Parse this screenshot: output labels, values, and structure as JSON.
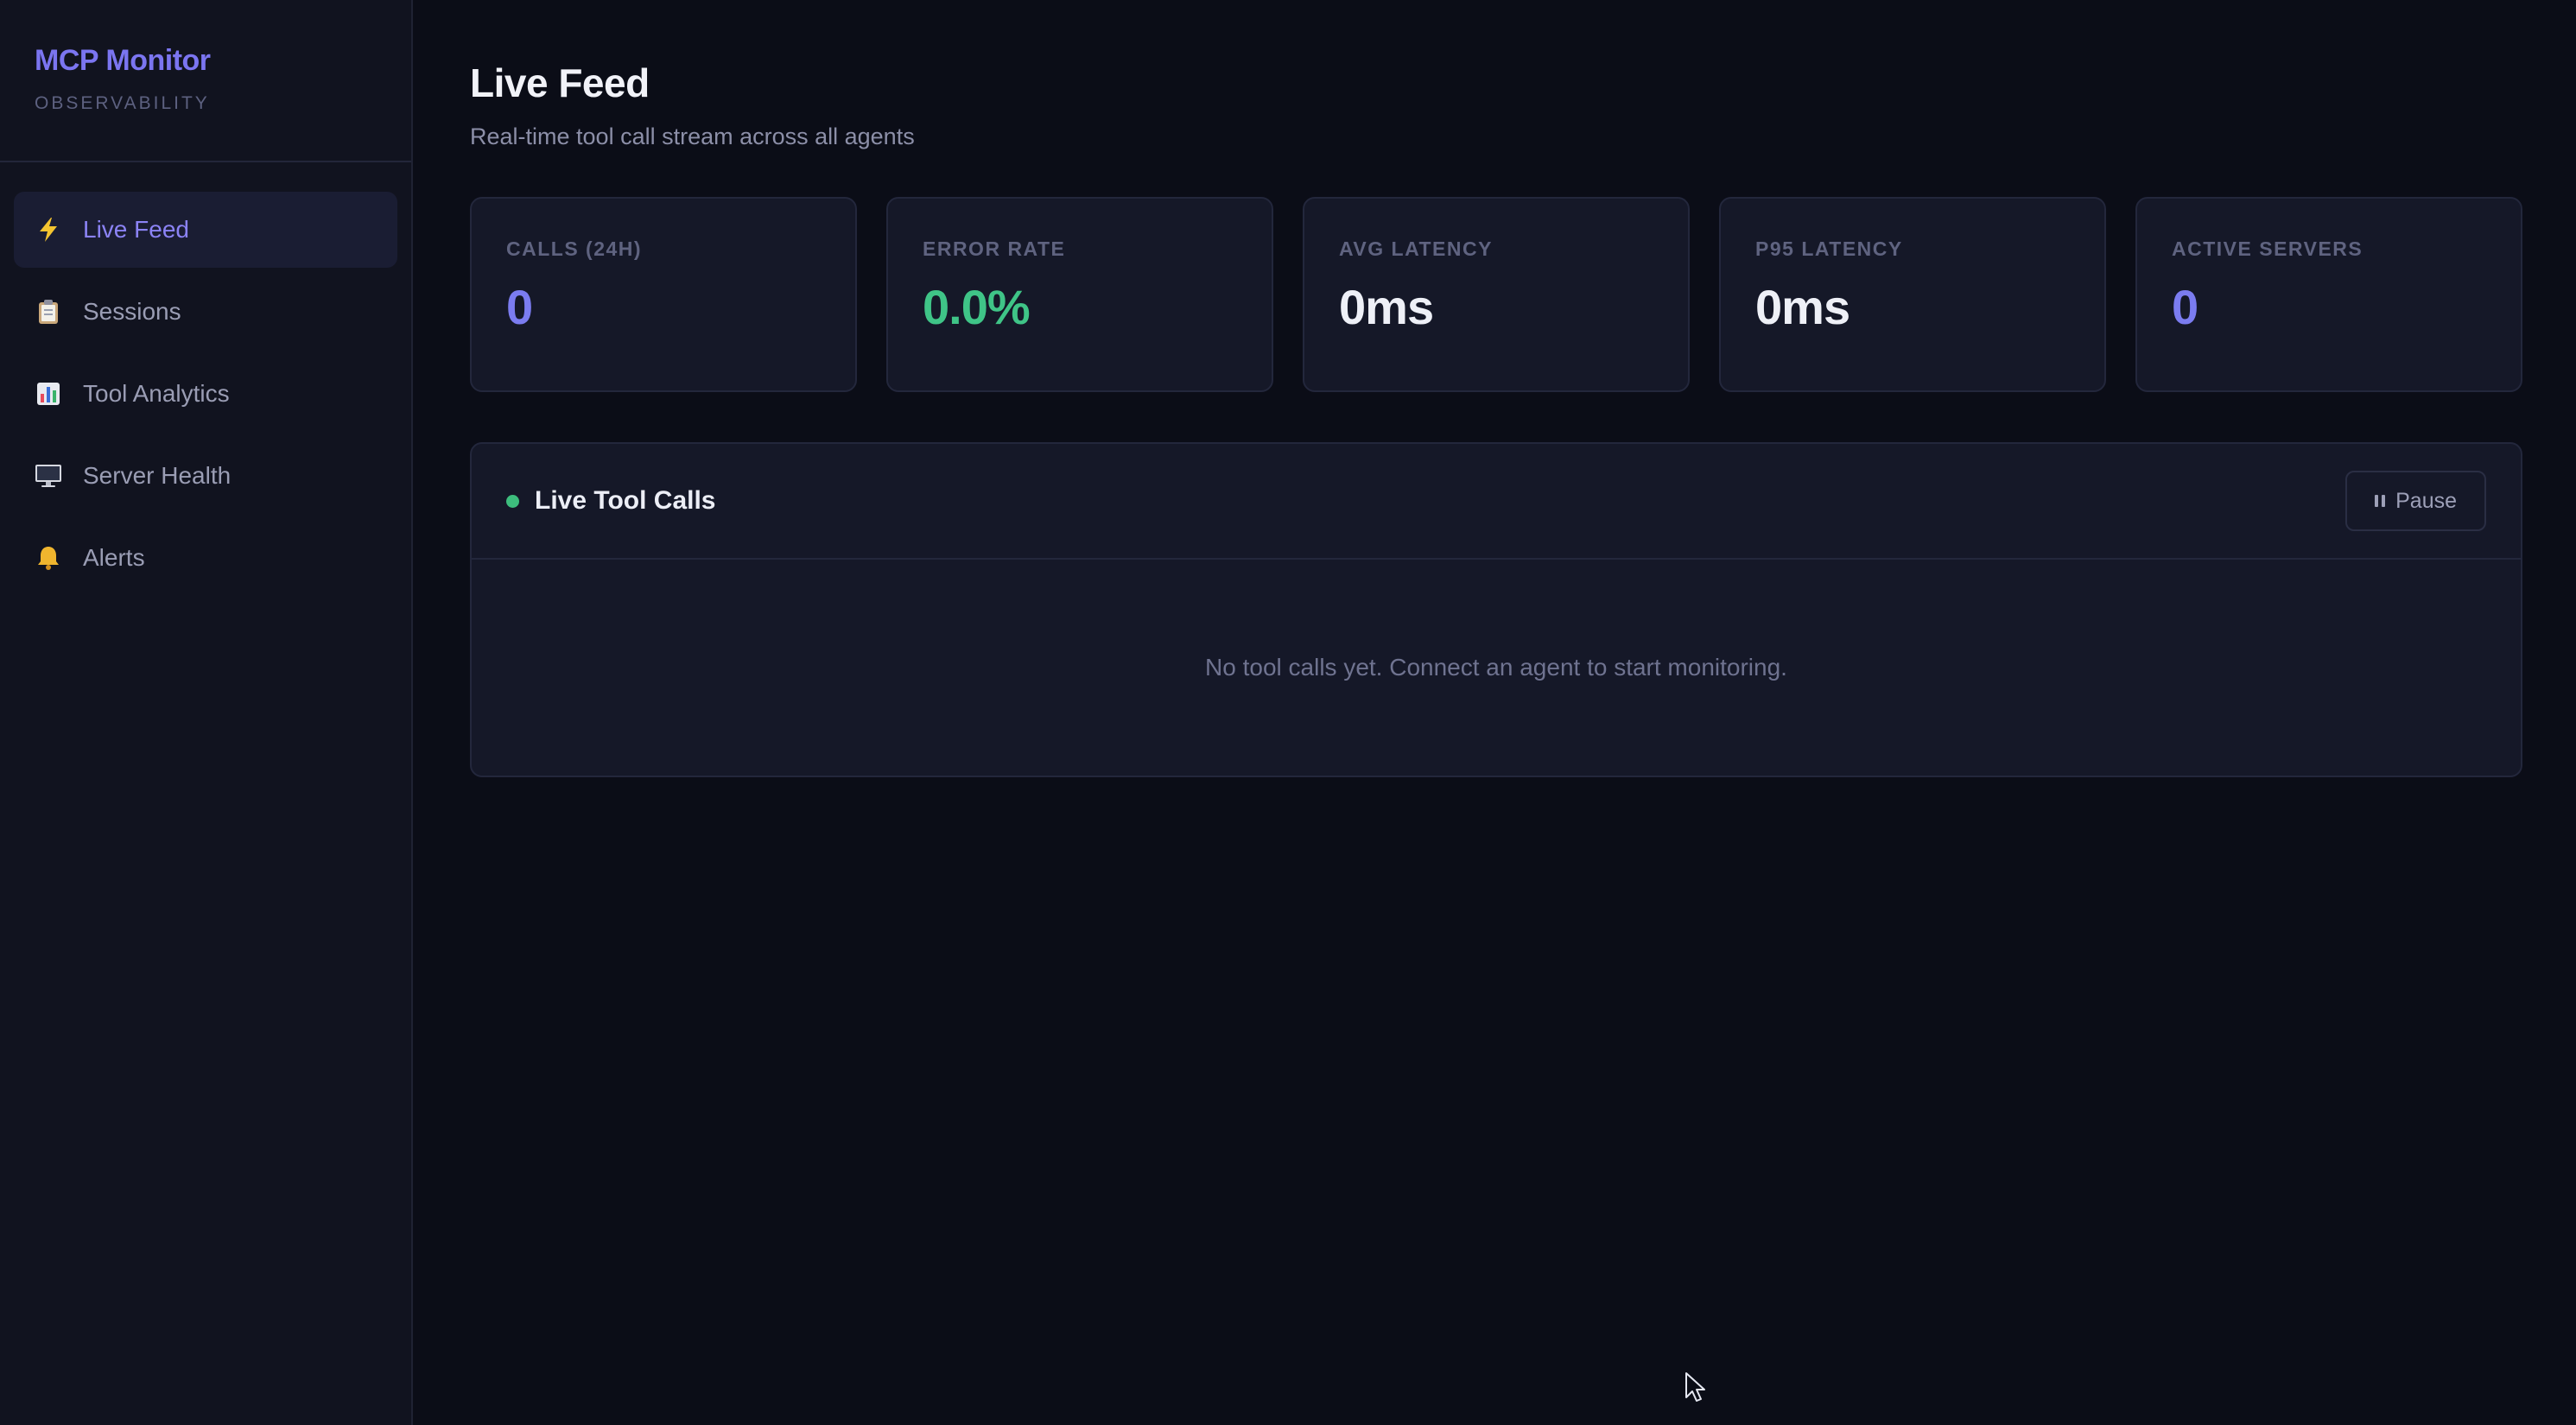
{
  "brand": {
    "title": "MCP Monitor",
    "subtitle": "OBSERVABILITY"
  },
  "sidebar": {
    "items": [
      {
        "label": "Live Feed",
        "icon": "lightning-icon",
        "active": true
      },
      {
        "label": "Sessions",
        "icon": "clipboard-icon",
        "active": false
      },
      {
        "label": "Tool Analytics",
        "icon": "bar-chart-icon",
        "active": false
      },
      {
        "label": "Server Health",
        "icon": "monitor-icon",
        "active": false
      },
      {
        "label": "Alerts",
        "icon": "bell-icon",
        "active": false
      }
    ]
  },
  "page": {
    "title": "Live Feed",
    "subtitle": "Real-time tool call stream across all agents"
  },
  "stats": [
    {
      "label": "CALLS (24H)",
      "value": "0",
      "color": "#7b7cf0"
    },
    {
      "label": "ERROR RATE",
      "value": "0.0%",
      "color": "#3fc487"
    },
    {
      "label": "AVG LATENCY",
      "value": "0ms",
      "color": "#eef0f7"
    },
    {
      "label": "P95 LATENCY",
      "value": "0ms",
      "color": "#eef0f7"
    },
    {
      "label": "ACTIVE SERVERS",
      "value": "0",
      "color": "#7b7cf0"
    }
  ],
  "live_panel": {
    "title": "Live Tool Calls",
    "pause_label": "Pause",
    "empty_message": "No tool calls yet. Connect an agent to start monitoring."
  },
  "colors": {
    "accent": "#7b75f0",
    "live_indicator": "#3dbd7d",
    "background": "#0b0d17",
    "sidebar": "#11131f",
    "card": "#151828"
  }
}
